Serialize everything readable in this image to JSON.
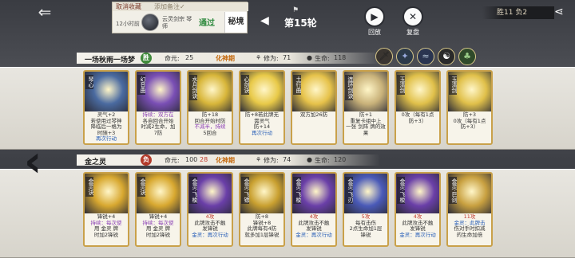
{
  "topbar": {
    "notice_cancel": "取消收藏",
    "notice_note": "添加备注✓",
    "notice_time": "12小时前",
    "notice_name": "云灵剑宗 琴师",
    "notice_pass": "通过",
    "notice_realm": "秘境",
    "round_label": "第15轮",
    "replay_label": "回放",
    "review_label": "复盘",
    "score": "胜11 负2"
  },
  "player_top": {
    "name": "一场秋雨一场梦",
    "seal": "胜",
    "hp_label": "命元:",
    "hp_value": "25",
    "realm": "化神期",
    "cultivation_label": "修为:",
    "cultivation_value": "71",
    "life_label": "生命:",
    "life_value": "118",
    "buff_icons": [
      "sword-icon",
      "feather-icon",
      "wave-icon",
      "yinyang-icon",
      "tree-icon"
    ]
  },
  "player_bottom": {
    "name": "金之灵",
    "seal": "负",
    "hp_label": "命元:",
    "hp_value": "100",
    "hp_delta": "28",
    "realm": "化神期",
    "cultivation_label": "修为:",
    "cultivation_value": "74",
    "life_label": "生命:",
    "life_value": "120"
  },
  "top_cards": [
    {
      "name": "琴心",
      "text": [
        "灵气+2",
        "若使用过琴神",
        "降临后一格为",
        "时随+3",
        "再次行动"
      ],
      "color": "#4a6aa0",
      "badge": ""
    },
    {
      "name": "幻音曲",
      "text": [
        "持续：双方在",
        "各自回合开始",
        "时减2生命，加",
        "7防"
      ],
      "color": "#7a4fb5",
      "badge": "◆"
    },
    {
      "name": "水月剑诀",
      "text": [
        "防+18",
        "回合开始时防",
        "不减半，持续",
        "5回合"
      ],
      "color": "#d8b63a",
      "badge": ""
    },
    {
      "name": "心剑诀",
      "text": [
        "防+8若此牌无",
        "需灵气",
        "防+14",
        "再次行动"
      ],
      "color": "#e8c948",
      "badge": ""
    },
    {
      "name": "土行曲",
      "text": [
        "双方加26防"
      ],
      "color": "#e6c24a",
      "badge": ""
    },
    {
      "name": "连环剑诀",
      "text": [
        "防+1",
        "重复卡组中上",
        "一张 剑阵 牌的效果"
      ],
      "color": "#c9b27a",
      "badge": ""
    },
    {
      "name": "玉清剑",
      "text": [
        "0攻（每有1点",
        "防+3）"
      ],
      "color": "#e0c04a",
      "badge": ""
    },
    {
      "name": "玉清剑",
      "text": [
        "防+3",
        "0攻（每有1点",
        "防+3）"
      ],
      "color": "#e0c04a",
      "badge": ""
    }
  ],
  "bottom_cards": [
    {
      "name": "金灵诀",
      "text": [
        "锋锐+4",
        "持续：每次使",
        "用 金灵 牌",
        "时加2锋锐"
      ],
      "color": "#d8a830",
      "badge": ""
    },
    {
      "name": "金灵诀",
      "text": [
        "锋锐+4",
        "持续：每次使",
        "用 金灵 牌",
        "时加2锋锐"
      ],
      "color": "#d8a830",
      "badge": ""
    },
    {
      "name": "金灵·飞梭",
      "text": [
        "4攻",
        "此牌攻击不触",
        "发锋锐",
        "金灵：再次行动"
      ],
      "color": "#6a3fa8",
      "badge": ""
    },
    {
      "name": "金灵·飞镖",
      "text": [
        "防+8",
        "锋锐+8",
        "此牌每有4防",
        "就多加1层锋锐"
      ],
      "color": "#c9a030",
      "badge": ""
    },
    {
      "name": "金灵·飞梭",
      "text": [
        "4攻",
        "此牌攻击不触",
        "发锋锐",
        "金灵：再次行动"
      ],
      "color": "#6a3fa8",
      "badge": ""
    },
    {
      "name": "金灵·飞刃",
      "text": [
        "5攻",
        "每有击伤",
        "2点生命加1层",
        "锋锐"
      ],
      "color": "#4a5ab8",
      "badge": ""
    },
    {
      "name": "金灵·飞梭",
      "text": [
        "4攻",
        "此牌攻击不触",
        "发锋锐",
        "金灵：再次行动"
      ],
      "color": "#6a3fa8",
      "badge": ""
    },
    {
      "name": "金灵·巨剑",
      "text": [
        "11攻",
        "金灵：此牌击",
        "伤对手时扣减",
        "的生命加倍"
      ],
      "color": "#c8a040",
      "badge": ""
    }
  ]
}
